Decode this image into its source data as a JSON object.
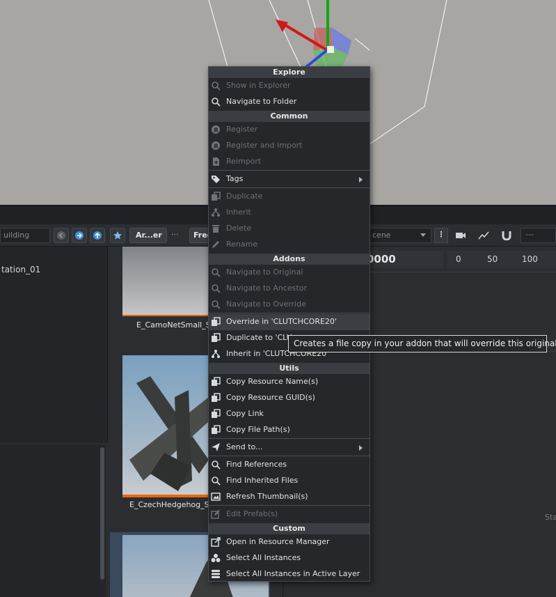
{
  "toolbar": {
    "search_value": "uilding",
    "crumb_current": "Ar...er",
    "crumb_dots": "···",
    "crumb_next": "Free",
    "scene_value": "cene",
    "kebab": "⋮",
    "dropdown_value": "---"
  },
  "tree": {
    "item": "tation_01"
  },
  "grid": {
    "tile1_label": "E_CamoNetSmall_S",
    "tile2_label": "E_CzechHedgehog_S",
    "accent": "#e8660a"
  },
  "timeline": {
    "header_value": "0000",
    "ticks": [
      "0",
      "50",
      "100"
    ],
    "stat_label": "Sta"
  },
  "menu": {
    "sections": {
      "explore": "Explore",
      "common": "Common",
      "addons": "Addons",
      "utils": "Utils",
      "custom": "Custom"
    },
    "items": {
      "show_in_explorer": "Show in Explorer",
      "navigate_to_folder": "Navigate to Folder",
      "register": "Register",
      "register_and_import": "Register and Import",
      "reimport": "Reimport",
      "tags": "Tags",
      "duplicate": "Duplicate",
      "inherit": "Inherit",
      "delete": "Delete",
      "rename": "Rename",
      "navigate_to_original": "Navigate to Original",
      "navigate_to_ancestor": "Navigate to Ancestor",
      "navigate_to_override": "Navigate to Override",
      "override_in": "Override in 'CLUTCHCORE20'",
      "duplicate_to": "Duplicate to 'CLU",
      "inherit_in": "Inherit in 'CLUTCHCORE20'",
      "copy_resource_names": "Copy Resource Name(s)",
      "copy_resource_guids": "Copy Resource GUID(s)",
      "copy_link": "Copy Link",
      "copy_file_paths": "Copy File Path(s)",
      "send_to": "Send to...",
      "find_references": "Find References",
      "find_inherited_files": "Find Inherited Files",
      "refresh_thumbnails": "Refresh Thumbnail(s)",
      "edit_prefabs": "Edit Prefab(s)",
      "open_in_resource_manager": "Open in Resource Manager",
      "select_all_instances": "Select All Instances",
      "select_all_instances_active_layer": "Select All Instances in Active Layer"
    }
  },
  "tooltip": {
    "text": "Creates a file copy in your addon that will override this original file"
  },
  "colors": {
    "viewport_bg": "#a8a6a2",
    "panel_bg": "#2b2d31",
    "menu_bg": "#25272b",
    "menu_header_bg": "#3a3d42",
    "gizmo_red": "#d01818",
    "gizmo_green": "#12a812",
    "gizmo_blue": "#2f48e0"
  }
}
